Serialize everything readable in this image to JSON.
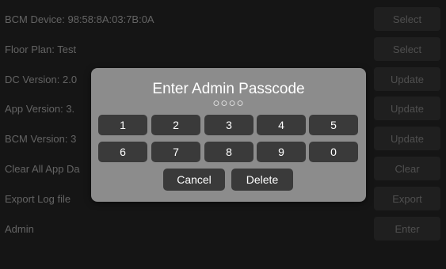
{
  "rows": [
    {
      "label": "BCM Device: 98:58:8A:03:7B:0A",
      "button": "Select"
    },
    {
      "label": "Floor Plan: Test",
      "button": "Select"
    },
    {
      "label": "DC Version: 2.0",
      "button": "Update"
    },
    {
      "label": "App Version: 3.",
      "button": "Update"
    },
    {
      "label": "BCM Version: 3",
      "button": "Update"
    },
    {
      "label": "Clear All App Da",
      "button": "Clear"
    },
    {
      "label": "Export Log file",
      "button": "Export"
    },
    {
      "label": "Admin",
      "button": "Enter"
    }
  ],
  "dialog": {
    "title": "Enter Admin Passcode",
    "passcode_dots": "○○○○",
    "keys": [
      "1",
      "2",
      "3",
      "4",
      "5",
      "6",
      "7",
      "8",
      "9",
      "0"
    ],
    "cancel_label": "Cancel",
    "delete_label": "Delete"
  },
  "colors": {
    "background": "#1e1e1e",
    "dialog": "#8c8c8c",
    "key": "#3a3a3a"
  }
}
